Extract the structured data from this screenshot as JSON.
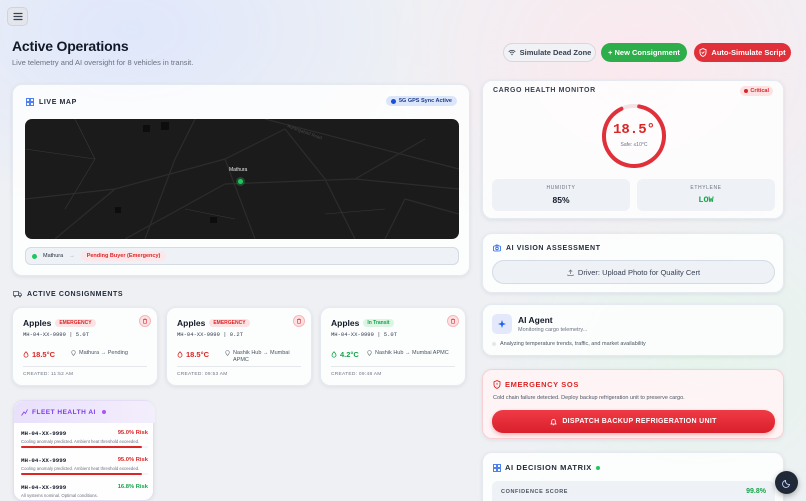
{
  "header": {
    "title": "Active Operations",
    "subtitle": "Live telemetry and AI oversight for 8 vehicles in transit.",
    "actions": {
      "dead_zone": "Simulate Dead Zone",
      "new_consignment": "+ New Consignment",
      "auto_simulate": "Auto-Simulate Script"
    }
  },
  "live_map": {
    "label": "LIVE MAP",
    "sync_badge": "5G GPS Sync Active",
    "marker_label": "Mathura",
    "route_origin": "Mathura",
    "route_dest": "Pending Buyer (Emergency)"
  },
  "consignments": {
    "label": "ACTIVE CONSIGNMENTS",
    "items": [
      {
        "name": "Apples",
        "badge": "EMERGENCY",
        "badge_type": "red",
        "meta": "MH-04-XX-9999  |  5.0T",
        "temp": "18.5°C",
        "temp_color": "#dc2626",
        "route": "Mathura → Pending",
        "created": "CREATED: 11:52 AM"
      },
      {
        "name": "Apples",
        "badge": "EMERGENCY",
        "badge_type": "red",
        "meta": "MH-04-XX-9999  |  0.2T",
        "temp": "18.5°C",
        "temp_color": "#dc2626",
        "route": "Nashik Hub → Mumbai APMC",
        "created": "CREATED: 09:53 AM"
      },
      {
        "name": "Apples",
        "badge": "In Transit",
        "badge_type": "green",
        "meta": "MH-04-XX-9999  |  5.0T",
        "temp": "4.2°C",
        "temp_color": "#16a34a",
        "route": "Nashik Hub → Mumbai APMC",
        "created": "CREATED: 09:48 AM"
      }
    ]
  },
  "fleet_health": {
    "label": "FLEET HEALTH AI",
    "rows": [
      {
        "id": "MH-04-XX-9999",
        "risk": "95.0% Risk",
        "risk_pct": 95,
        "color": "#dc2626",
        "msg": "Cooling anomaly predicted. Ambient heat threshold exceeded."
      },
      {
        "id": "MH-04-XX-9999",
        "risk": "95.0% Risk",
        "risk_pct": 95,
        "color": "#dc2626",
        "msg": "Cooling anomaly predicted. Ambient heat threshold exceeded."
      },
      {
        "id": "MH-04-XX-9999",
        "risk": "16.8% Risk",
        "risk_pct": 16.8,
        "color": "#16a34a",
        "msg": "All systems nominal. Optimal conditions."
      }
    ]
  },
  "cargo_monitor": {
    "label": "CARGO HEALTH MONITOR",
    "status": "Critical",
    "temperature": "18.5°",
    "safe_range": "Safe: ≤10°C",
    "humidity_label": "HUMIDITY",
    "humidity_value": "85%",
    "ethylene_label": "ETHYLENE",
    "ethylene_value": "LOW"
  },
  "vision": {
    "label": "AI VISION ASSESSMENT",
    "upload": "Driver: Upload Photo for Quality Cert"
  },
  "agent": {
    "title": "AI Agent",
    "subtitle": "Monitoring cargo telemetry...",
    "status": "Analyzing temperature trends, traffic, and market availability"
  },
  "sos": {
    "label": "EMERGENCY SOS",
    "message": "Cold chain failure detected. Deploy backup refrigeration unit to preserve cargo.",
    "action": "DISPATCH BACKUP REFRIGERATION UNIT"
  },
  "decision_matrix": {
    "label": "AI DECISION MATRIX",
    "confidence_label": "CONFIDENCE SCORE",
    "confidence_value": "99.8%"
  },
  "colors": {
    "accent_green": "#2eae4b",
    "accent_red": "#e0303a",
    "accent_purple": "#7c3aed",
    "accent_blue": "#2563eb"
  }
}
